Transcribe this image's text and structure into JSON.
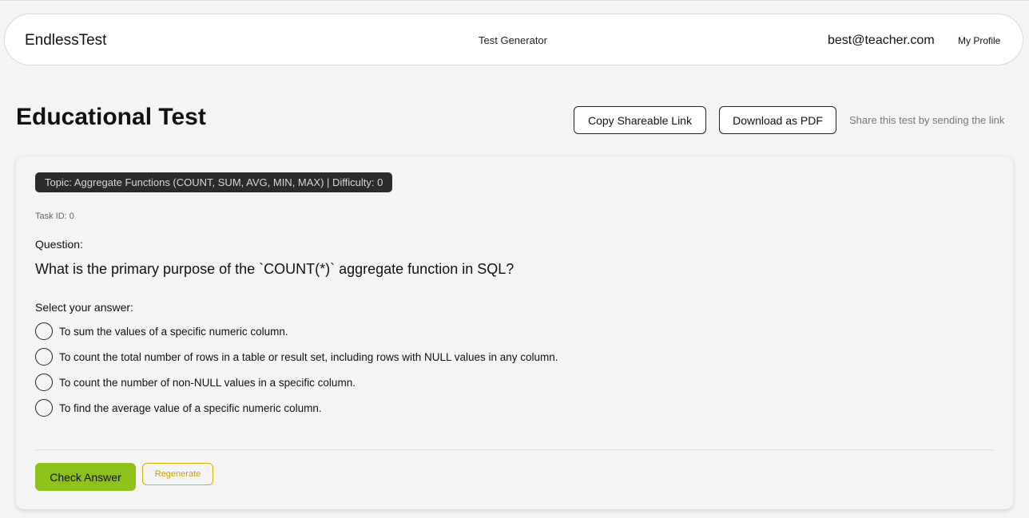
{
  "navbar": {
    "brand": "EndlessTest",
    "center_link": "Test Generator",
    "user_email": "best@teacher.com",
    "profile_link": "My Profile"
  },
  "header": {
    "title": "Educational Test",
    "copy_link_button": "Copy Shareable Link",
    "download_pdf_button": "Download as PDF",
    "share_hint": "Share this test by sending the link"
  },
  "task": {
    "topic_badge": "Topic: Aggregate Functions (COUNT, SUM, AVG, MIN, MAX) | Difficulty: 0",
    "task_id": "Task ID: 0",
    "question_label": "Question:",
    "question_text": "What is the primary purpose of the `COUNT(*)` aggregate function in SQL?",
    "select_label": "Select your answer:",
    "options": [
      {
        "label": "To sum the values of a specific numeric column."
      },
      {
        "label": "To count the total number of rows in a table or result set, including rows with NULL values in any column."
      },
      {
        "label": "To count the number of non-NULL values in a specific column."
      },
      {
        "label": "To find the average value of a specific numeric column."
      }
    ],
    "check_button": "Check Answer",
    "regenerate_button": "Regenerate"
  },
  "colors": {
    "background": "#f4f4f4",
    "check_button": "#8cc21a",
    "regenerate_accent": "#c9a200",
    "badge_background": "#2b2b2b"
  }
}
